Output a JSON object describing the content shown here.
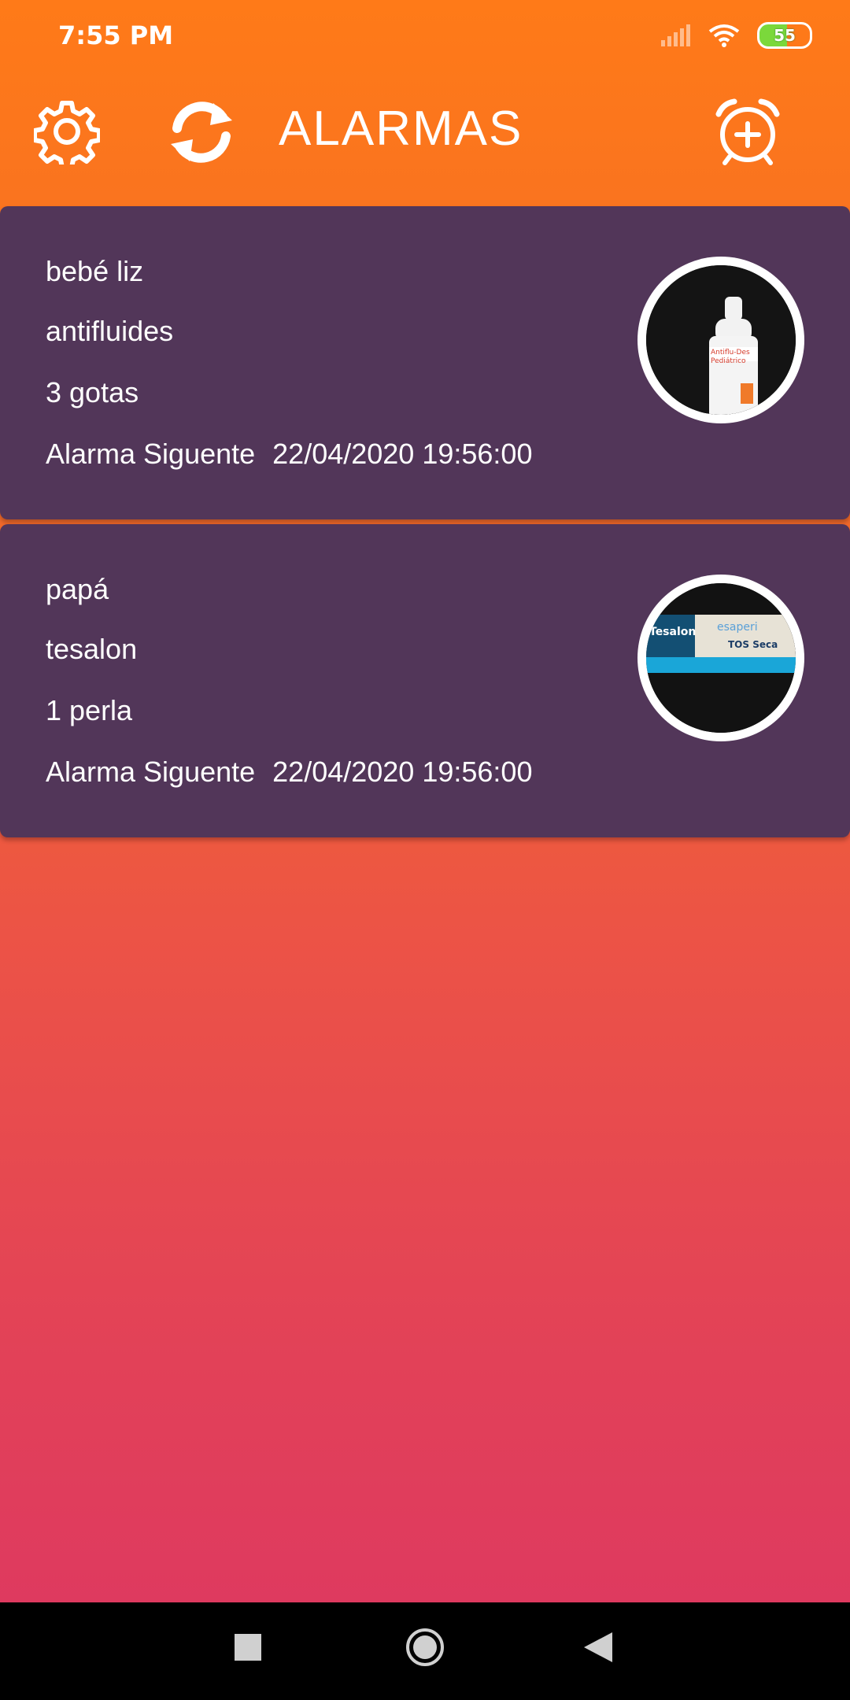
{
  "status": {
    "time": "7:55 PM",
    "battery": "55"
  },
  "appbar": {
    "title": "ALARMAS"
  },
  "alarms": [
    {
      "person": "bebé liz",
      "medicine": "antifluides",
      "dose": "3 gotas",
      "next_label": "Alarma Siguente",
      "next_time": "22/04/2020 19:56:00",
      "image_labels": [
        "Antiflu-Des",
        "Pediátrico"
      ]
    },
    {
      "person": "papá",
      "medicine": "tesalon",
      "dose": "1 perla",
      "next_label": "Alarma Siguente",
      "next_time": "22/04/2020 19:56:00",
      "image_labels": [
        "Tesalon",
        "esaperi",
        "TOS Seca"
      ]
    }
  ],
  "colors": {
    "card": "#523659",
    "accent_top": "#FF7A18",
    "accent_bottom": "#DD3762"
  }
}
